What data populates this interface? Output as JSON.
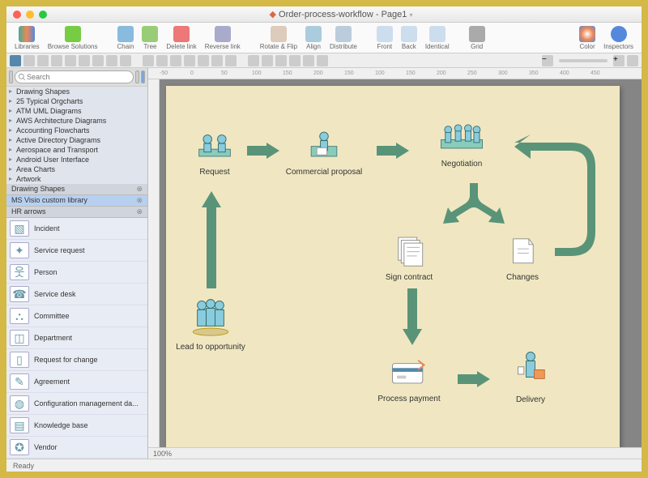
{
  "window": {
    "title": "Order-process-workflow - Page1"
  },
  "toolbar": [
    {
      "label": "Libraries",
      "icon": "books"
    },
    {
      "label": "Browse Solutions",
      "icon": "browse"
    },
    {
      "label": "Chain",
      "icon": "chain"
    },
    {
      "label": "Tree",
      "icon": "tree"
    },
    {
      "label": "Delete link",
      "icon": "del"
    },
    {
      "label": "Reverse link",
      "icon": "rev"
    },
    {
      "label": "Rotate & Flip",
      "icon": "rot"
    },
    {
      "label": "Align",
      "icon": "align"
    },
    {
      "label": "Distribute",
      "icon": "dist"
    },
    {
      "label": "Front",
      "icon": "front"
    },
    {
      "label": "Back",
      "icon": "back"
    },
    {
      "label": "Identical",
      "icon": "ident"
    },
    {
      "label": "Grid",
      "icon": "grid"
    },
    {
      "label": "Color",
      "icon": "color"
    },
    {
      "label": "Inspectors",
      "icon": "insp"
    }
  ],
  "search": {
    "placeholder": "Search"
  },
  "shape_categories": [
    "Drawing Shapes",
    "25 Typical Orgcharts",
    "ATM UML Diagrams",
    "AWS Architecture Diagrams",
    "Accounting Flowcharts",
    "Active Directory Diagrams",
    "Aerospace and Transport",
    "Android User Interface",
    "Area Charts",
    "Artwork"
  ],
  "library_tabs": [
    {
      "name": "Drawing Shapes",
      "active": false
    },
    {
      "name": "MS Visio custom library",
      "active": true
    },
    {
      "name": "HR arrows",
      "active": false
    }
  ],
  "library_items": [
    {
      "label": "Incident",
      "glyph": "▧"
    },
    {
      "label": "Service request",
      "glyph": "✦"
    },
    {
      "label": "Person",
      "glyph": "웃"
    },
    {
      "label": "Service desk",
      "glyph": "☎"
    },
    {
      "label": "Committee",
      "glyph": "⛬"
    },
    {
      "label": "Department",
      "glyph": "◫"
    },
    {
      "label": "Request for change",
      "glyph": "▯"
    },
    {
      "label": "Agreement",
      "glyph": "✎"
    },
    {
      "label": "Configuration management da...",
      "glyph": "◍"
    },
    {
      "label": "Knowledge base",
      "glyph": "▤"
    },
    {
      "label": "Vendor",
      "glyph": "✪"
    }
  ],
  "diagram_nodes": {
    "lead": "Lead to opportunity",
    "request": "Request",
    "proposal": "Commercial proposal",
    "negotiation": "Negotiation",
    "sign": "Sign contract",
    "changes": "Changes",
    "payment": "Process payment",
    "delivery": "Delivery"
  },
  "ruler_marks_h": [
    "-50",
    "0",
    "50",
    "100",
    "150",
    "200",
    "150",
    "100",
    "150",
    "200",
    "250",
    "300",
    "350",
    "400",
    "450"
  ],
  "zoom": "100%",
  "status": "Ready"
}
